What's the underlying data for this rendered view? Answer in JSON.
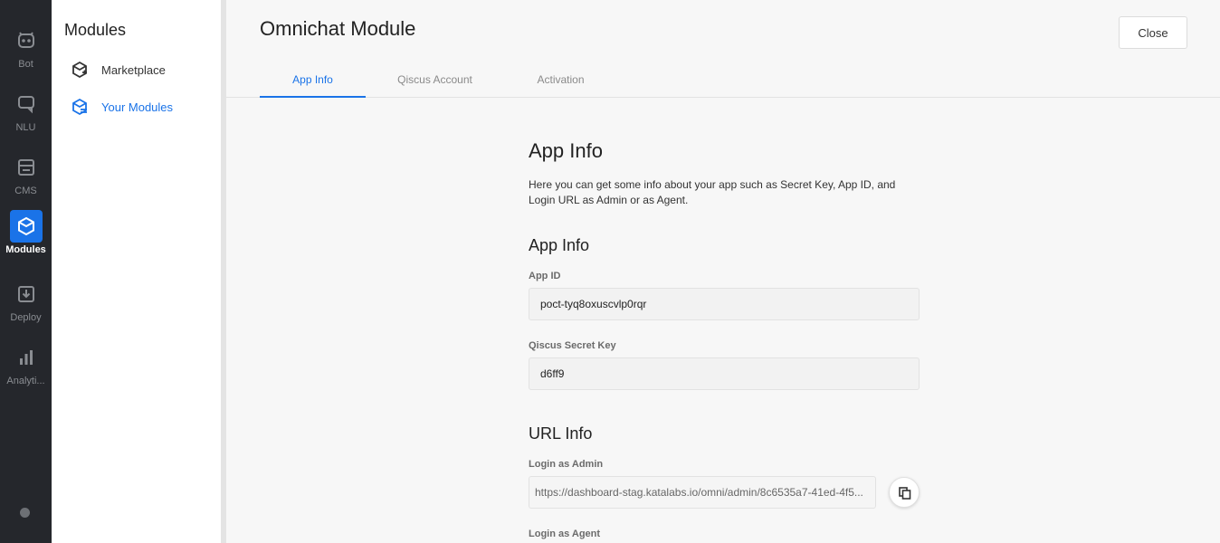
{
  "rail": {
    "items": [
      {
        "label": "Bot",
        "icon": "bot-icon"
      },
      {
        "label": "NLU",
        "icon": "nlu-icon"
      },
      {
        "label": "CMS",
        "icon": "cms-icon"
      },
      {
        "label": "Modules",
        "icon": "modules-icon"
      },
      {
        "label": "Deploy",
        "icon": "deploy-icon"
      },
      {
        "label": "Analyti...",
        "icon": "analytics-icon"
      }
    ],
    "active": "Modules"
  },
  "subnav": {
    "title": "Modules",
    "items": [
      {
        "label": "Marketplace",
        "icon": "marketplace-icon"
      },
      {
        "label": "Your Modules",
        "icon": "your-modules-icon"
      }
    ],
    "active": "Your Modules"
  },
  "header": {
    "title": "Omnichat Module",
    "close_label": "Close"
  },
  "tabs": [
    {
      "label": "App Info"
    },
    {
      "label": "Qiscus Account"
    },
    {
      "label": "Activation"
    }
  ],
  "active_tab": "App Info",
  "content": {
    "heading": "App Info",
    "description": "Here you can get some info about your app such as Secret Key, App ID, and Login URL as Admin or as Agent.",
    "app_info": {
      "heading": "App Info",
      "app_id_label": "App ID",
      "app_id_value": "poct-tyq8oxuscvlp0rqr",
      "secret_label": "Qiscus Secret Key",
      "secret_value": "d6ff9"
    },
    "url_info": {
      "heading": "URL Info",
      "admin_label": "Login as Admin",
      "admin_value": "https://dashboard-stag.katalabs.io/omni/admin/8c6535a7-41ed-4f5...",
      "agent_label": "Login as Agent"
    }
  },
  "colors": {
    "accent": "#1a73e8",
    "rail_bg": "#25272c"
  }
}
